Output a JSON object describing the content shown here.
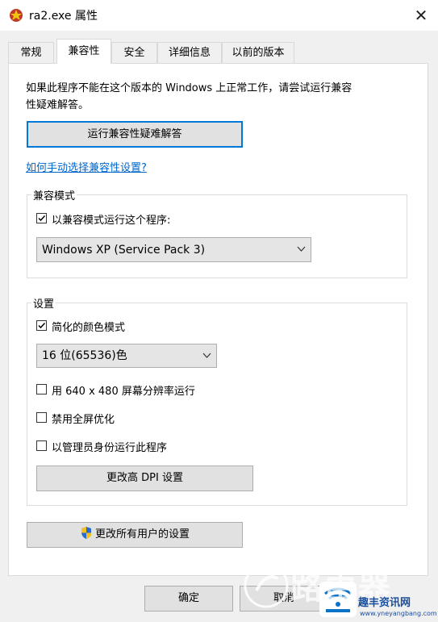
{
  "window": {
    "title": "ra2.exe 属性",
    "icon": "ra2-app-icon",
    "close_icon": "close-icon"
  },
  "tabs": [
    {
      "label": "常规",
      "active": false
    },
    {
      "label": "兼容性",
      "active": true
    },
    {
      "label": "安全",
      "active": false
    },
    {
      "label": "详细信息",
      "active": false
    },
    {
      "label": "以前的版本",
      "active": false
    }
  ],
  "compat": {
    "intro_line1": "如果此程序不能在这个版本的 Windows 上正常工作，请尝试运行兼容",
    "intro_line2": "性疑难解答。",
    "troubleshoot_button": "运行兼容性疑难解答",
    "manual_link": "如何手动选择兼容性设置?"
  },
  "compat_mode": {
    "group_label": "兼容模式",
    "checkbox_label": "以兼容模式运行这个程序:",
    "checked": true,
    "selected_os": "Windows XP (Service Pack 3)"
  },
  "settings": {
    "group_label": "设置",
    "reduced_color": {
      "label": "简化的颜色模式",
      "checked": true
    },
    "color_depth": "16 位(65536)色",
    "res_640": {
      "label": "用 640 x 480 屏幕分辨率运行",
      "checked": false
    },
    "disable_fullscreen": {
      "label": "禁用全屏优化",
      "checked": false
    },
    "run_as_admin": {
      "label": "以管理员身份运行此程序",
      "checked": false
    },
    "dpi_button": "更改高 DPI 设置"
  },
  "all_users_button": "更改所有用户的设置",
  "footer": {
    "ok": "确定",
    "cancel": "取消"
  },
  "watermark": {
    "text": "路由器",
    "brand": "趣丰资讯网",
    "url": "www.yneyangbang.com"
  },
  "colors": {
    "accent": "#0078d7",
    "link": "#0066cc",
    "shield_blue": "#2a6ad0",
    "shield_yellow": "#f4c01e"
  }
}
